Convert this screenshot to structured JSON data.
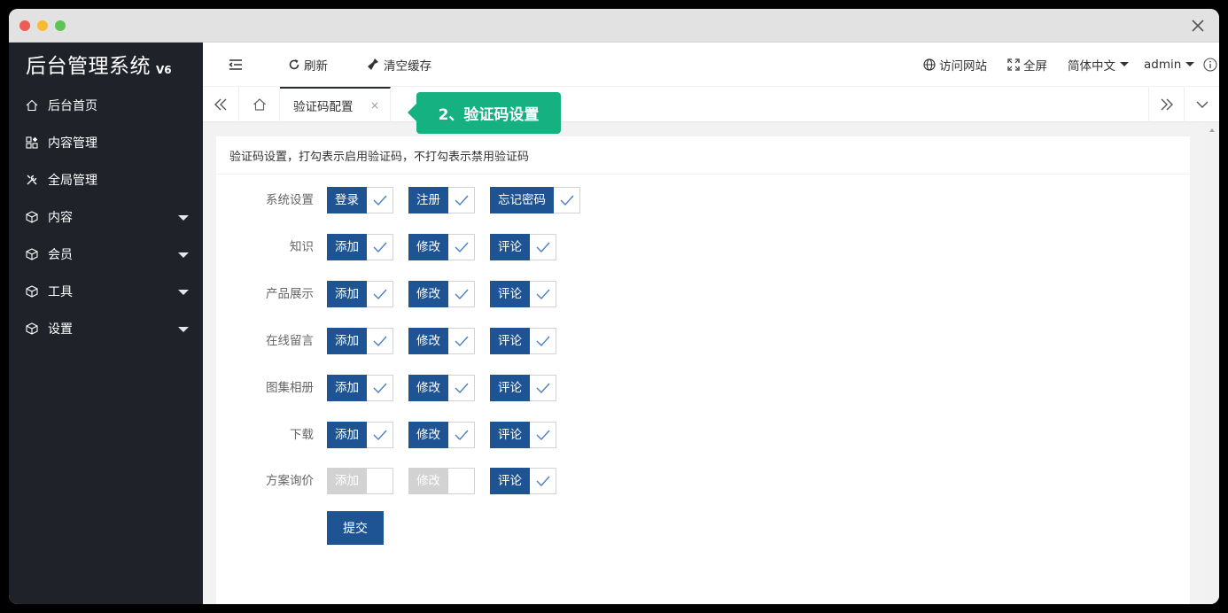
{
  "app": {
    "logo_name": "后台管理系统",
    "logo_version": "V6"
  },
  "sidebar": {
    "items": [
      {
        "label": "后台首页",
        "icon": "home-icon"
      },
      {
        "label": "内容管理",
        "icon": "apps-icon"
      },
      {
        "label": "全局管理",
        "icon": "tools-icon"
      },
      {
        "label": "内容",
        "icon": "cube-icon",
        "expandable": true
      },
      {
        "label": "会员",
        "icon": "cube-icon",
        "expandable": true
      },
      {
        "label": "工具",
        "icon": "cube-icon",
        "expandable": true
      },
      {
        "label": "设置",
        "icon": "cube-icon",
        "expandable": true
      }
    ]
  },
  "header": {
    "refresh": "刷新",
    "clear_cache": "清空缓存",
    "visit_site": "访问网站",
    "fullscreen": "全屏",
    "language": "简体中文",
    "user": "admin"
  },
  "tabs": {
    "active": "验证码配置",
    "close": "×"
  },
  "callout": "2、验证码设置",
  "form": {
    "description": "验证码设置，打勾表示启用验证码，不打勾表示禁用验证码",
    "rows": [
      {
        "label": "系统设置",
        "options": [
          {
            "label": "登录",
            "checked": true
          },
          {
            "label": "注册",
            "checked": true
          },
          {
            "label": "忘记密码",
            "checked": true
          }
        ]
      },
      {
        "label": "知识",
        "options": [
          {
            "label": "添加",
            "checked": true
          },
          {
            "label": "修改",
            "checked": true
          },
          {
            "label": "评论",
            "checked": true
          }
        ]
      },
      {
        "label": "产品展示",
        "options": [
          {
            "label": "添加",
            "checked": true
          },
          {
            "label": "修改",
            "checked": true
          },
          {
            "label": "评论",
            "checked": true
          }
        ]
      },
      {
        "label": "在线留言",
        "options": [
          {
            "label": "添加",
            "checked": true
          },
          {
            "label": "修改",
            "checked": true
          },
          {
            "label": "评论",
            "checked": true
          }
        ]
      },
      {
        "label": "图集相册",
        "options": [
          {
            "label": "添加",
            "checked": true
          },
          {
            "label": "修改",
            "checked": true
          },
          {
            "label": "评论",
            "checked": true
          }
        ]
      },
      {
        "label": "下载",
        "options": [
          {
            "label": "添加",
            "checked": true
          },
          {
            "label": "修改",
            "checked": true
          },
          {
            "label": "评论",
            "checked": true
          }
        ]
      },
      {
        "label": "方案询价",
        "options": [
          {
            "label": "添加",
            "checked": false
          },
          {
            "label": "修改",
            "checked": false
          },
          {
            "label": "评论",
            "checked": true
          }
        ]
      }
    ],
    "submit": "提交"
  },
  "colors": {
    "sidebar_bg": "#20222a",
    "primary": "#1e5494",
    "callout": "#16b181",
    "checkmark": "#4a7fc1"
  }
}
